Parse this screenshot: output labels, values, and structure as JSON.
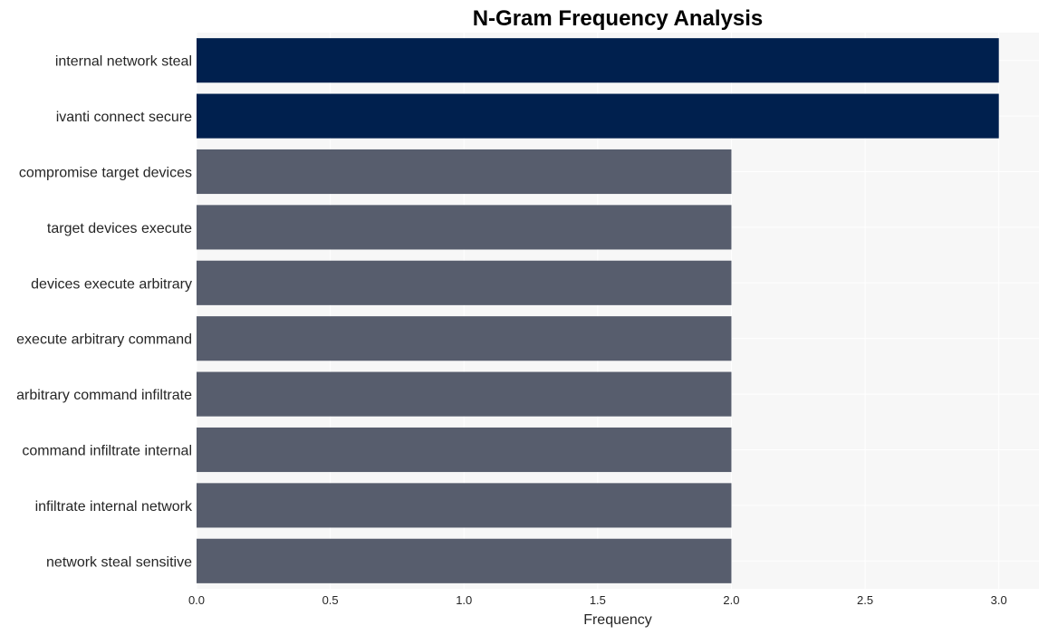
{
  "chart_data": {
    "type": "bar",
    "orientation": "horizontal",
    "title": "N-Gram Frequency Analysis",
    "xlabel": "Frequency",
    "ylabel": "",
    "xlim": [
      0,
      3.15
    ],
    "xticks": [
      0.0,
      0.5,
      1.0,
      1.5,
      2.0,
      2.5,
      3.0
    ],
    "xtick_labels": [
      "0.0",
      "0.5",
      "1.0",
      "1.5",
      "2.0",
      "2.5",
      "3.0"
    ],
    "grid": true,
    "categories": [
      "internal network steal",
      "ivanti connect secure",
      "compromise target devices",
      "target devices execute",
      "devices execute arbitrary",
      "execute arbitrary command",
      "arbitrary command infiltrate",
      "command infiltrate internal",
      "infiltrate internal network",
      "network steal sensitive"
    ],
    "values": [
      3,
      3,
      2,
      2,
      2,
      2,
      2,
      2,
      2,
      2
    ],
    "colors": {
      "highlight": "#00204e",
      "default": "#575d6d",
      "plot_background": "#f7f7f7",
      "grid": "#ffffff"
    }
  }
}
